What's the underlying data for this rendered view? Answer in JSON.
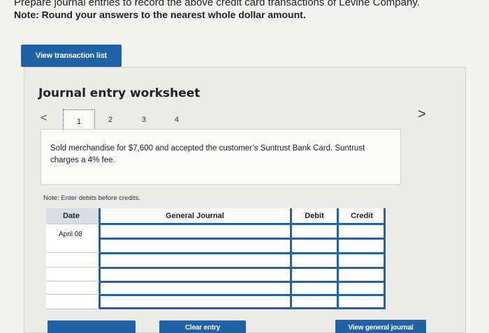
{
  "instructions": "Prepare journal entries to record the above credit card transactions of Levine Company.",
  "note_top": "Note: Round your answers to the nearest whole dollar amount.",
  "view_transaction_list": "View transaction list",
  "worksheet_title": "Journal entry worksheet",
  "nav": {
    "prev": "<",
    "next": ">"
  },
  "steps": [
    "1",
    "2",
    "3",
    "4"
  ],
  "description": "Sold merchandise for $7,600 and accepted the customer’s Suntrust Bank Card. Suntrust charges a 4% fee.",
  "note_debits": "Note: Enter debits before credits.",
  "table": {
    "headers": {
      "date": "Date",
      "general_journal": "General Journal",
      "debit": "Debit",
      "credit": "Credit"
    },
    "rows": [
      {
        "date": "April 08",
        "account": "",
        "debit": "",
        "credit": ""
      },
      {
        "date": "",
        "account": "",
        "debit": "",
        "credit": ""
      },
      {
        "date": "",
        "account": "",
        "debit": "",
        "credit": ""
      },
      {
        "date": "",
        "account": "",
        "debit": "",
        "credit": ""
      },
      {
        "date": "",
        "account": "",
        "debit": "",
        "credit": ""
      },
      {
        "date": "",
        "account": "",
        "debit": "",
        "credit": ""
      }
    ]
  },
  "buttons": {
    "clear_entry": "Clear entry",
    "view_general_journal": "View general journal"
  },
  "colors": {
    "accent": "#1f63a6",
    "panel": "#ebebe9",
    "date_header": "#d7dde6"
  }
}
